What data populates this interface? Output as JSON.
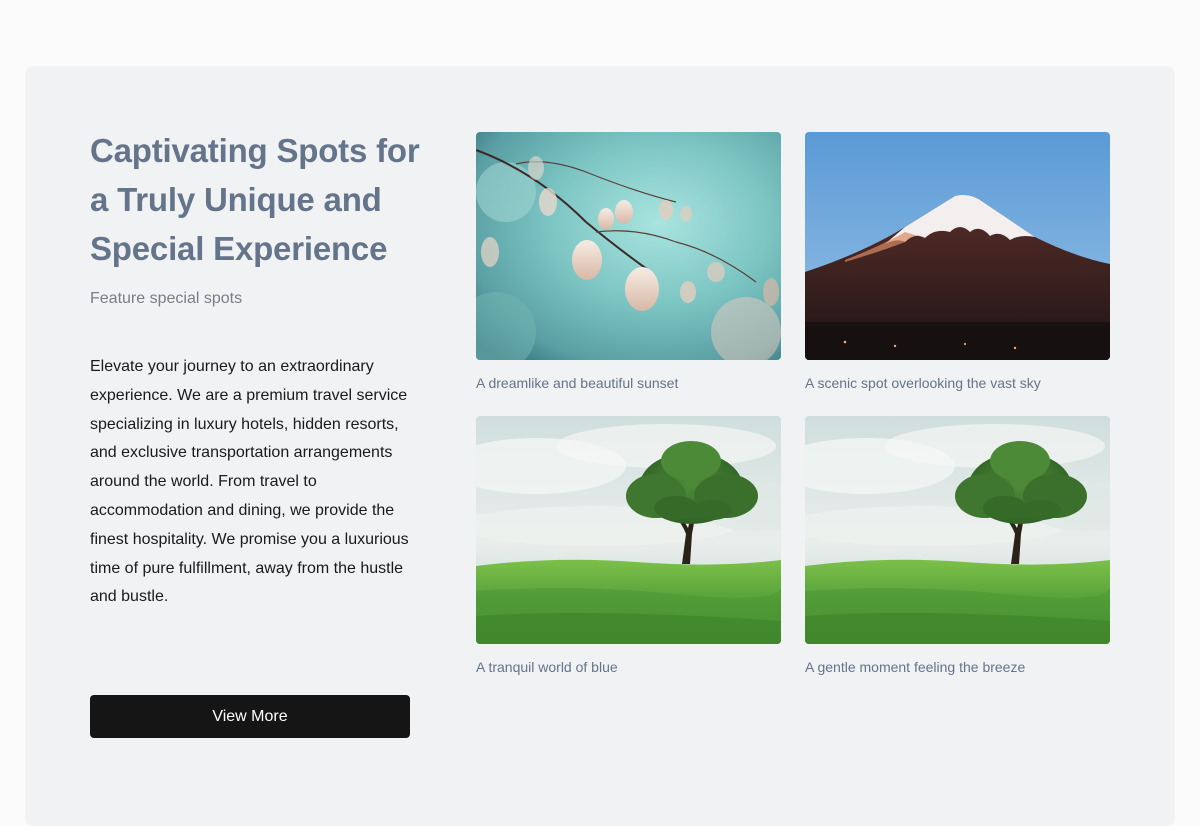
{
  "feature": {
    "heading": "Captivating Spots for a Truly Unique and Special Experience",
    "subheading": "Feature special spots",
    "description": "Elevate your journey to an extraordinary experience. We are a premium travel service specializing in luxury hotels, hidden resorts, and exclusive transportation arrangements around the world. From travel to accommodation and dining, we provide the finest hospitality. We promise you a luxurious time of pure fulfillment, away from the hustle and bustle.",
    "button_label": "View More"
  },
  "spots": [
    {
      "caption": "A dreamlike and beautiful sunset",
      "image": "leaves-branch-teal-bokeh"
    },
    {
      "caption": "A scenic spot overlooking the vast sky",
      "image": "snowcapped-mountain-blue-sky"
    },
    {
      "caption": "A tranquil world of blue",
      "image": "lone-tree-green-field"
    },
    {
      "caption": "A gentle moment feeling the breeze",
      "image": "lone-tree-green-field"
    }
  ],
  "colors": {
    "page_background": "#fbfbfb",
    "section_background": "#f1f2f4",
    "heading": "#64748b",
    "button_background": "#151515",
    "button_text": "#ffffff",
    "caption": "#64748b"
  }
}
